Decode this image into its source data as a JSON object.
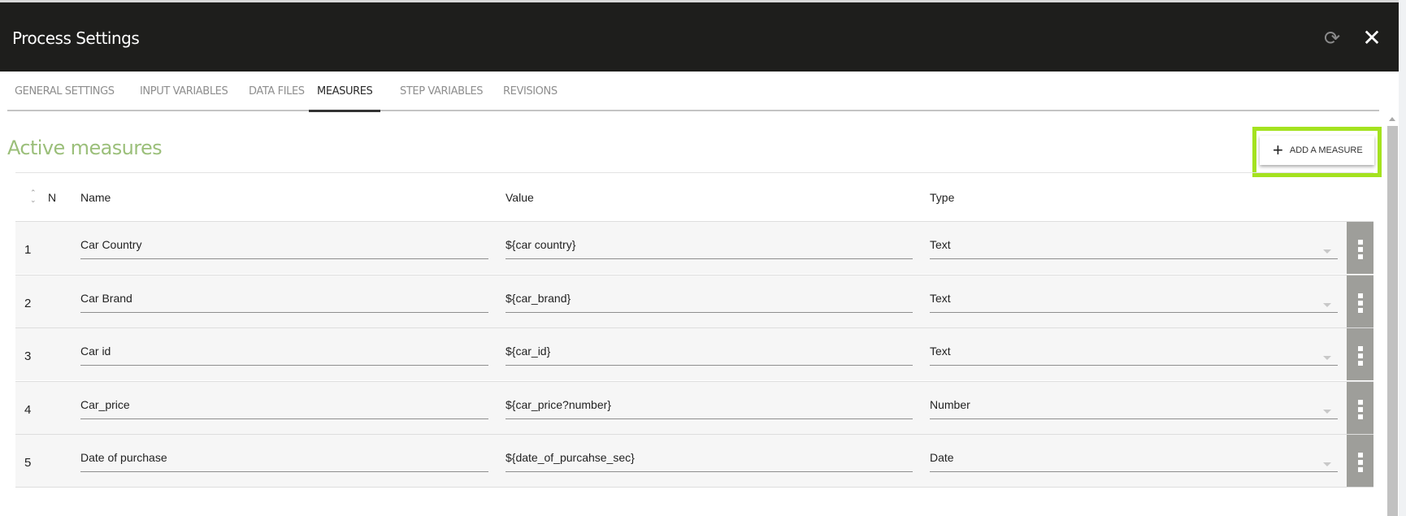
{
  "header": {
    "title": "Process Settings",
    "refresh_icon": "refresh-icon",
    "close_icon": "close-icon"
  },
  "tabs": [
    {
      "label": "GENERAL SETTINGS",
      "active": false
    },
    {
      "label": "INPUT VARIABLES",
      "active": false
    },
    {
      "label": "DATA FILES",
      "active": false
    },
    {
      "label": "MEASURES",
      "active": true
    },
    {
      "label": "STEP VARIABLES",
      "active": false
    },
    {
      "label": "REVISIONS",
      "active": false
    }
  ],
  "section": {
    "title": "Active measures",
    "add_button": "ADD A MEASURE",
    "highlight_color": "#a4e21f",
    "title_color": "#9bbf7a"
  },
  "table": {
    "columns": [
      "N",
      "Name",
      "Value",
      "Type"
    ],
    "rows": [
      {
        "n": "1",
        "name": "Car Country",
        "value": "${car country}",
        "type": "Text"
      },
      {
        "n": "2",
        "name": "Car Brand",
        "value": "${car_brand}",
        "type": "Text"
      },
      {
        "n": "3",
        "name": "Car id",
        "value": "${car_id}",
        "type": "Text"
      },
      {
        "n": "4",
        "name": "Car_price",
        "value": "${car_price?number}",
        "type": "Number"
      },
      {
        "n": "5",
        "name": "Date of purchase",
        "value": "${date_of_purcahse_sec}",
        "type": "Date"
      }
    ]
  }
}
